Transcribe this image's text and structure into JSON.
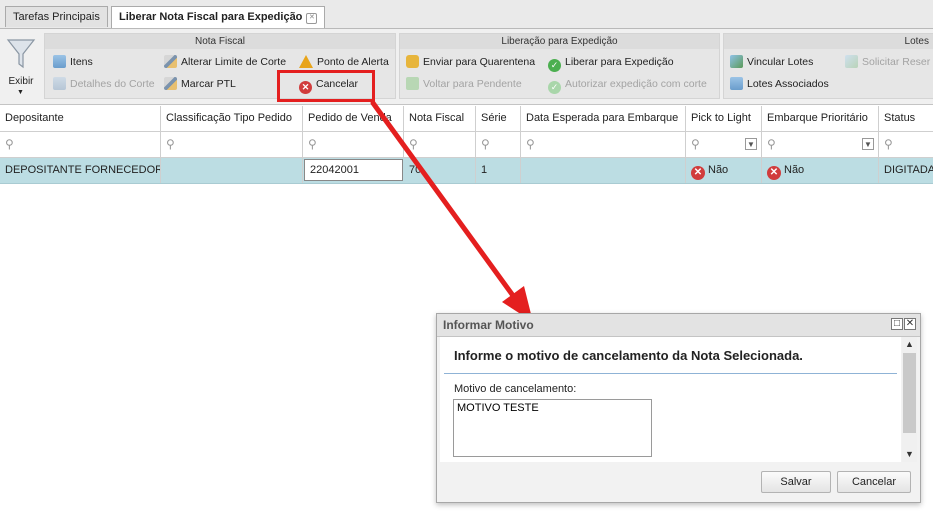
{
  "tabs": [
    {
      "label": "Tarefas Principais"
    },
    {
      "label": "Liberar Nota Fiscal para Expedição"
    }
  ],
  "ribbon": {
    "exibir_label": "Exibir",
    "groups": [
      {
        "title": "Nota Fiscal"
      },
      {
        "title": "Liberação para Expedição"
      },
      {
        "title": "Lotes"
      }
    ],
    "buttons": {
      "itens": "Itens",
      "detalhes_corte": "Detalhes do Corte",
      "alterar_limite": "Alterar Limite de Corte",
      "marcar_ptl": "Marcar PTL",
      "ponto_alerta": "Ponto de Alerta",
      "cancelar": "Cancelar",
      "enviar_quarentena": "Enviar para Quarentena",
      "voltar_pendente": "Voltar para Pendente",
      "liberar_expedicao": "Liberar para Expedição",
      "autorizar_corte": "Autorizar expedição com corte",
      "vincular_lotes": "Vincular Lotes",
      "lotes_associados": "Lotes Associados",
      "solicitar_reserva": "Solicitar Reser"
    }
  },
  "grid": {
    "columns": [
      "Depositante",
      "Classificação Tipo Pedido",
      "Pedido de Venda",
      "Nota Fiscal",
      "Série",
      "Data Esperada para Embarque",
      "Pick to Light",
      "Embarque Prioritário",
      "Status"
    ],
    "filter_icon": "search-icon",
    "row": {
      "depositante": "DEPOSITANTE FORNECEDOR B",
      "classificacao": "",
      "pedido": "22042001",
      "nota": "70",
      "serie": "1",
      "data": "",
      "pick_to_light": "Não",
      "embarque_prioritario": "Não",
      "status": "DIGITADA"
    }
  },
  "dialog": {
    "title": "Informar Motivo",
    "heading": "Informe o motivo de cancelamento da Nota Selecionada.",
    "field_label": "Motivo de cancelamento:",
    "field_value": "MOTIVO TESTE",
    "save_label": "Salvar",
    "cancel_label": "Cancelar"
  },
  "annotation": {
    "color": "#e41f1f"
  }
}
